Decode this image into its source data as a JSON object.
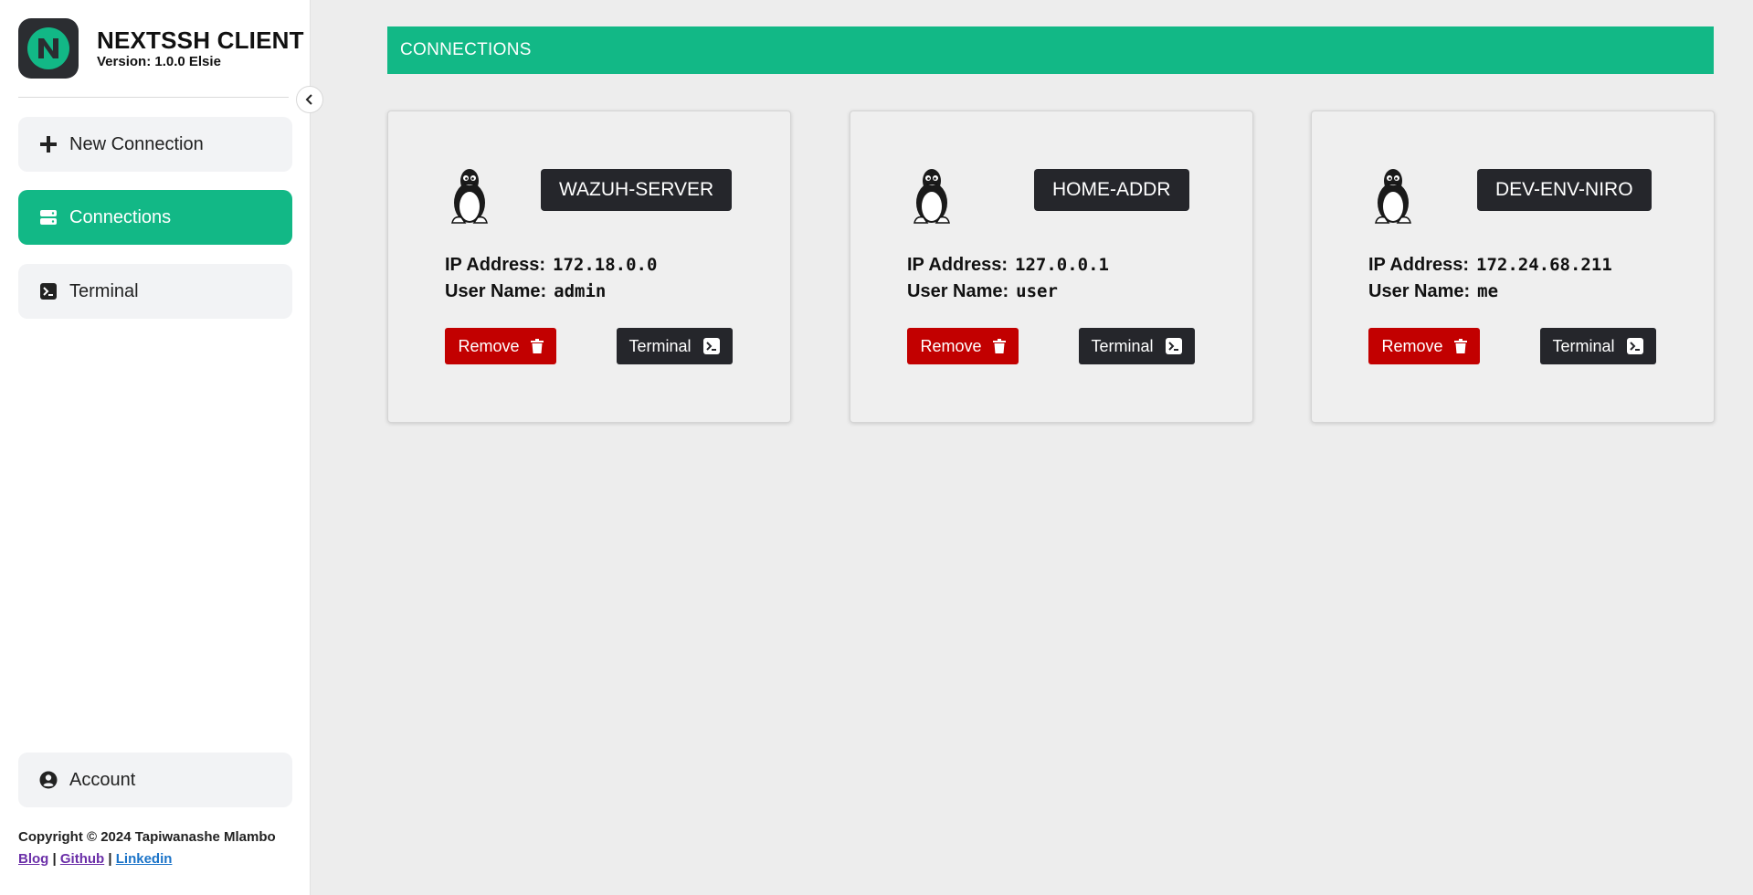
{
  "app": {
    "title": "NEXTSSH CLIENT",
    "version": "Version: 1.0.0 Elsie",
    "logo_letter": "N"
  },
  "sidebar": {
    "items": [
      {
        "label": "New Connection",
        "icon": "plus-icon"
      },
      {
        "label": "Connections",
        "icon": "server-icon",
        "active": true
      },
      {
        "label": "Terminal",
        "icon": "terminal-icon"
      }
    ],
    "account": {
      "label": "Account",
      "icon": "user-circle-icon"
    },
    "copyright": "Copyright © 2024 Tapiwanashe Mlambo",
    "links": [
      {
        "label": "Blog"
      },
      {
        "label": "Github"
      },
      {
        "label": "Linkedin"
      }
    ],
    "link_separator": "|"
  },
  "main": {
    "header": "CONNECTIONS",
    "ip_label": "IP Address:",
    "user_label": "User Name:",
    "remove_label": "Remove",
    "terminal_label": "Terminal",
    "connections": [
      {
        "name": "WAZUH-SERVER",
        "ip": "172.18.0.0",
        "user": "admin",
        "os_icon": "linux-penguin-icon"
      },
      {
        "name": "HOME-ADDR",
        "ip": "127.0.0.1",
        "user": "user",
        "os_icon": "linux-penguin-icon"
      },
      {
        "name": "DEV-ENV-NIRO",
        "ip": "172.24.68.211",
        "user": "me",
        "os_icon": "linux-penguin-icon"
      }
    ]
  },
  "colors": {
    "accent": "#12b886",
    "danger": "#c20000",
    "dark": "#25262b"
  }
}
